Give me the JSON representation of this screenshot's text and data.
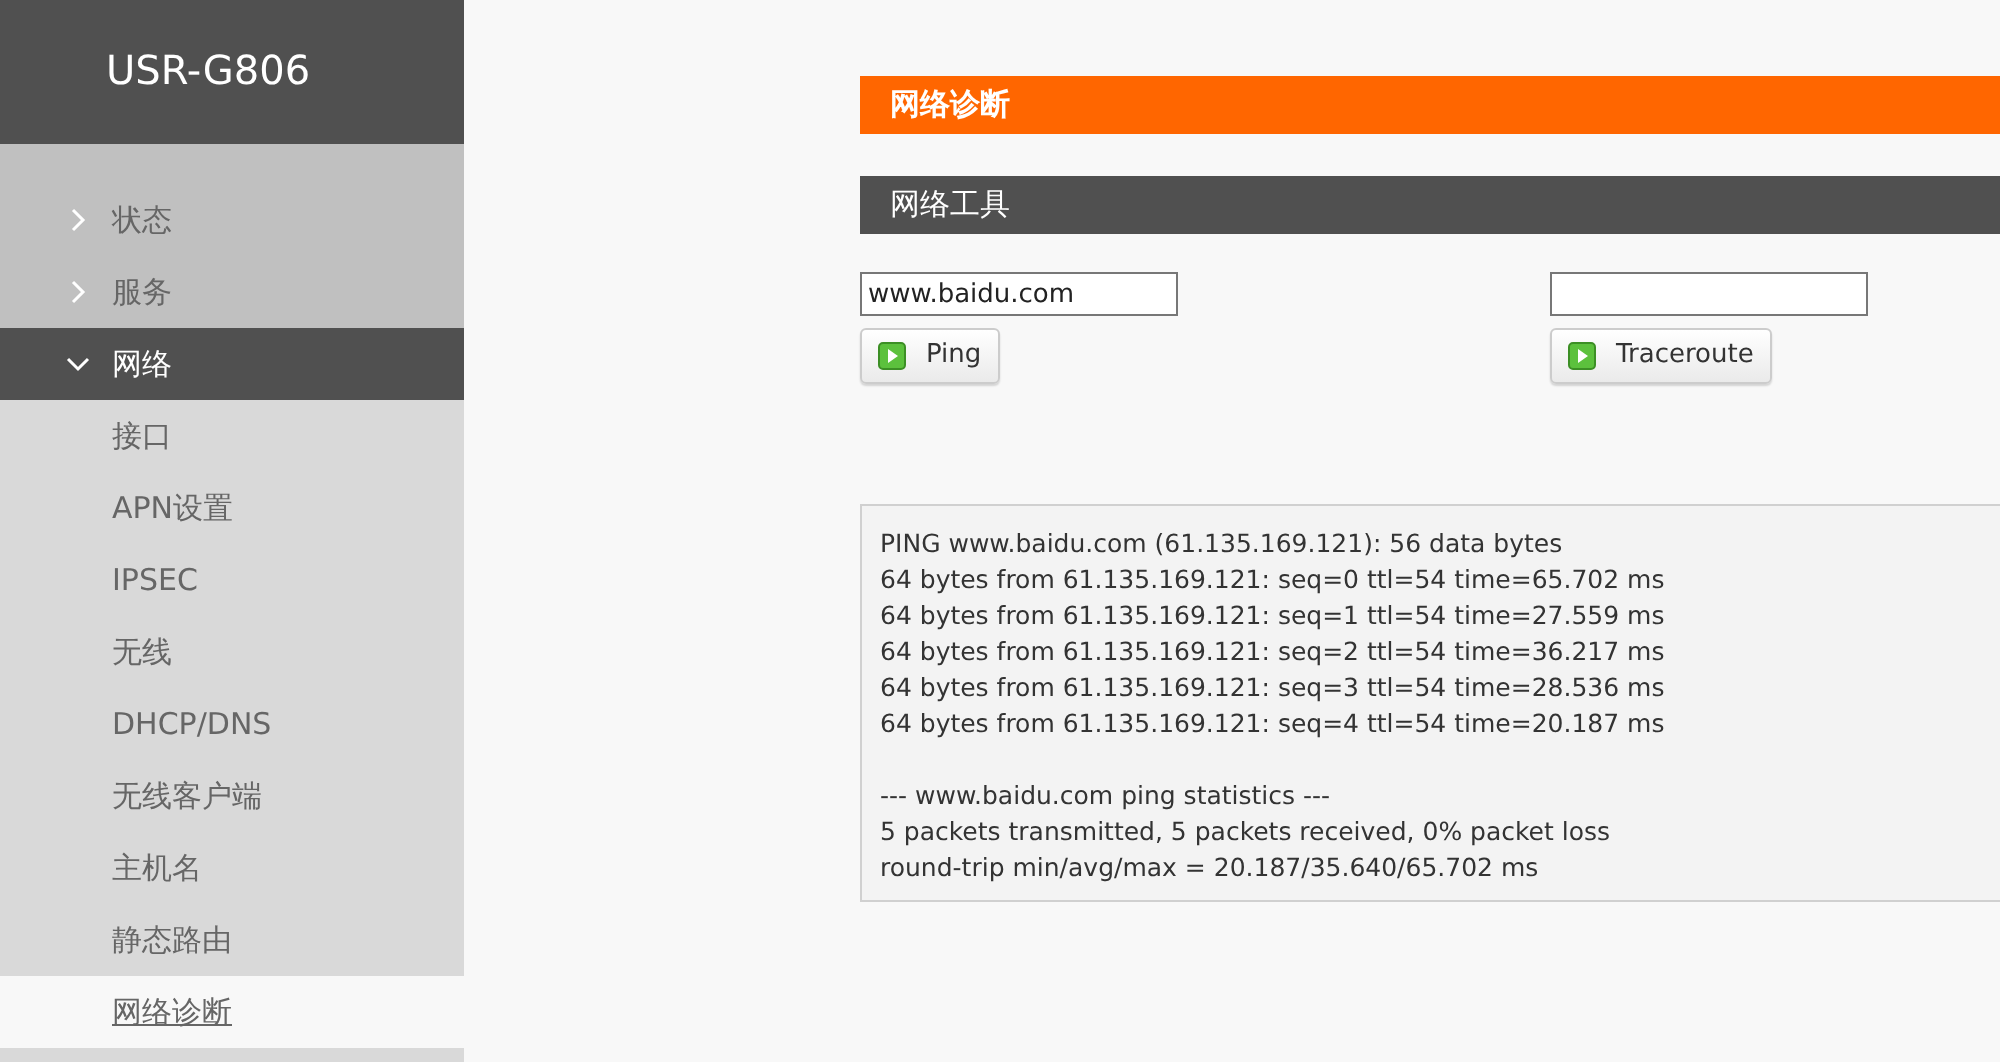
{
  "brand": "USR-G806",
  "menu": [
    {
      "label": "状态",
      "expanded": false
    },
    {
      "label": "服务",
      "expanded": false
    },
    {
      "label": "网络",
      "expanded": true,
      "children": [
        {
          "label": "接口",
          "selected": false
        },
        {
          "label": "APN设置",
          "selected": false
        },
        {
          "label": "IPSEC",
          "selected": false
        },
        {
          "label": "无线",
          "selected": false
        },
        {
          "label": "DHCP/DNS",
          "selected": false
        },
        {
          "label": "无线客户端",
          "selected": false
        },
        {
          "label": "主机名",
          "selected": false
        },
        {
          "label": "静态路由",
          "selected": false
        },
        {
          "label": "网络诊断",
          "selected": true
        }
      ]
    }
  ],
  "page_title": "网络诊断",
  "section_title": "网络工具",
  "tools": [
    {
      "value": "www.baidu.com",
      "button": "Ping"
    },
    {
      "button": "Traceroute"
    }
  ],
  "output": {
    "paragraphs": [
      [
        "PING www.baidu.com (61.135.169.121): 56 data bytes",
        "64 bytes from 61.135.169.121: seq=0 ttl=54 time=65.702 ms",
        "64 bytes from 61.135.169.121: seq=1 ttl=54 time=27.559 ms",
        "64 bytes from 61.135.169.121: seq=2 ttl=54 time=36.217 ms",
        "64 bytes from 61.135.169.121: seq=3 ttl=54 time=28.536 ms",
        "64 bytes from 61.135.169.121: seq=4 ttl=54 time=20.187 ms"
      ],
      [
        "--- www.baidu.com ping statistics ---",
        "5 packets transmitted, 5 packets received, 0% packet loss",
        "round-trip min/avg/max = 20.187/35.640/65.702 ms"
      ]
    ]
  }
}
